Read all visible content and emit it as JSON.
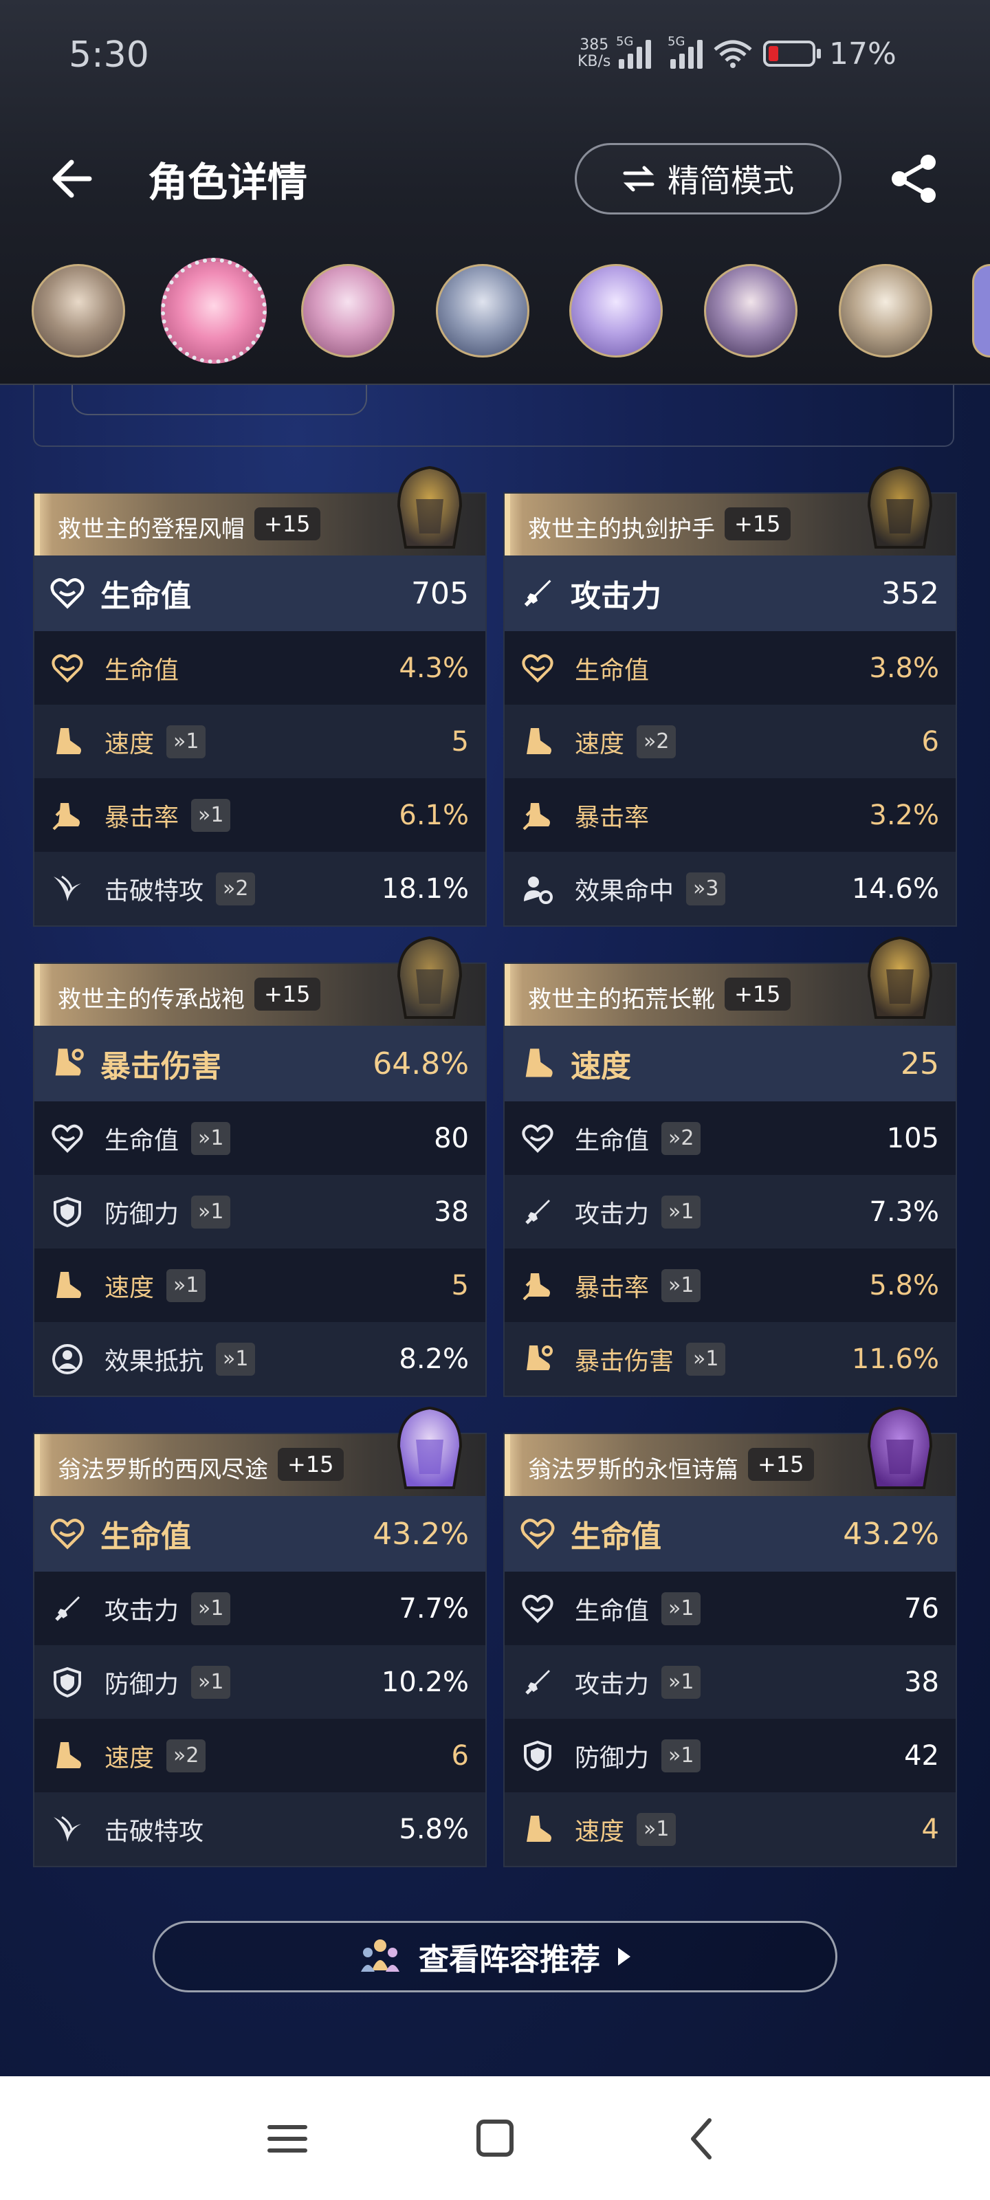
{
  "status": {
    "time": "5:30",
    "net_speed": "385",
    "net_unit": "KB/s",
    "sig1": "5G",
    "sig2": "5G",
    "battery": "17%"
  },
  "header": {
    "title": "角色详情",
    "mode_label": "精简模式"
  },
  "colors": {
    "gold": "#f1c987",
    "accent_bg": "#2a3550"
  },
  "relics": [
    {
      "name": "救世主的登程风帽",
      "level": "+15",
      "main": {
        "icon": "heart-icon",
        "name": "生命值",
        "value": "705",
        "gold": false
      },
      "subs": [
        {
          "icon": "heart-icon",
          "name": "生命值",
          "roll": "",
          "value": "4.3%",
          "gold": true
        },
        {
          "icon": "boot-icon",
          "name": "速度",
          "roll": "»1",
          "value": "5",
          "gold": true
        },
        {
          "icon": "crit-icon",
          "name": "暴击率",
          "roll": "»1",
          "value": "6.1%",
          "gold": true
        },
        {
          "icon": "break-icon",
          "name": "击破特攻",
          "roll": "»2",
          "value": "18.1%",
          "gold": false
        }
      ]
    },
    {
      "name": "救世主的执剑护手",
      "level": "+15",
      "main": {
        "icon": "sword-icon",
        "name": "攻击力",
        "value": "352",
        "gold": false
      },
      "subs": [
        {
          "icon": "heart-icon",
          "name": "生命值",
          "roll": "",
          "value": "3.8%",
          "gold": true
        },
        {
          "icon": "boot-icon",
          "name": "速度",
          "roll": "»2",
          "value": "6",
          "gold": true
        },
        {
          "icon": "crit-icon",
          "name": "暴击率",
          "roll": "",
          "value": "3.2%",
          "gold": true
        },
        {
          "icon": "effect-hit-icon",
          "name": "效果命中",
          "roll": "»3",
          "value": "14.6%",
          "gold": false
        }
      ]
    },
    {
      "name": "救世主的传承战袍",
      "level": "+15",
      "main": {
        "icon": "crit-dmg-icon",
        "name": "暴击伤害",
        "value": "64.8%",
        "gold": true
      },
      "subs": [
        {
          "icon": "heart-icon",
          "name": "生命值",
          "roll": "»1",
          "value": "80",
          "gold": false
        },
        {
          "icon": "shield-icon",
          "name": "防御力",
          "roll": "»1",
          "value": "38",
          "gold": false
        },
        {
          "icon": "boot-icon",
          "name": "速度",
          "roll": "»1",
          "value": "5",
          "gold": true
        },
        {
          "icon": "effect-res-icon",
          "name": "效果抵抗",
          "roll": "»1",
          "value": "8.2%",
          "gold": false
        }
      ]
    },
    {
      "name": "救世主的拓荒长靴",
      "level": "+15",
      "main": {
        "icon": "boot-icon",
        "name": "速度",
        "value": "25",
        "gold": true
      },
      "subs": [
        {
          "icon": "heart-icon",
          "name": "生命值",
          "roll": "»2",
          "value": "105",
          "gold": false
        },
        {
          "icon": "sword-icon",
          "name": "攻击力",
          "roll": "»1",
          "value": "7.3%",
          "gold": false
        },
        {
          "icon": "crit-icon",
          "name": "暴击率",
          "roll": "»1",
          "value": "5.8%",
          "gold": true
        },
        {
          "icon": "crit-dmg-icon",
          "name": "暴击伤害",
          "roll": "»1",
          "value": "11.6%",
          "gold": true
        }
      ]
    },
    {
      "name": "翁法罗斯的西风尽途",
      "level": "+15",
      "main": {
        "icon": "heart-icon",
        "name": "生命值",
        "value": "43.2%",
        "gold": true
      },
      "subs": [
        {
          "icon": "sword-icon",
          "name": "攻击力",
          "roll": "»1",
          "value": "7.7%",
          "gold": false
        },
        {
          "icon": "shield-icon",
          "name": "防御力",
          "roll": "»1",
          "value": "10.2%",
          "gold": false
        },
        {
          "icon": "boot-icon",
          "name": "速度",
          "roll": "»2",
          "value": "6",
          "gold": true
        },
        {
          "icon": "break-icon",
          "name": "击破特攻",
          "roll": "",
          "value": "5.8%",
          "gold": false
        }
      ]
    },
    {
      "name": "翁法罗斯的永恒诗篇",
      "level": "+15",
      "main": {
        "icon": "heart-icon",
        "name": "生命值",
        "value": "43.2%",
        "gold": true
      },
      "subs": [
        {
          "icon": "heart-icon",
          "name": "生命值",
          "roll": "»1",
          "value": "76",
          "gold": false
        },
        {
          "icon": "sword-icon",
          "name": "攻击力",
          "roll": "»1",
          "value": "38",
          "gold": false
        },
        {
          "icon": "shield-icon",
          "name": "防御力",
          "roll": "»1",
          "value": "42",
          "gold": false
        },
        {
          "icon": "boot-icon",
          "name": "速度",
          "roll": "»1",
          "value": "4",
          "gold": true
        }
      ]
    }
  ],
  "footer": {
    "recommend_label": "查看阵容推荐"
  }
}
